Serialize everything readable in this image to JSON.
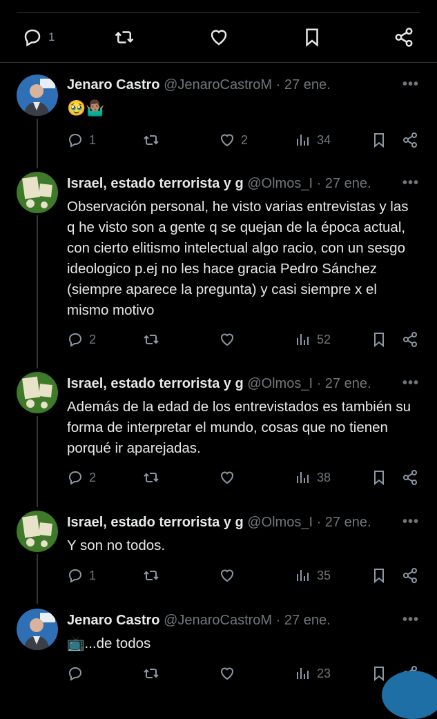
{
  "top_actions": {
    "reply_count": "1"
  },
  "tweets": [
    {
      "name": "Jenaro Castro",
      "handle": "@JenaroCastroM",
      "dot": "·",
      "date": "27 ene.",
      "more": "•••",
      "text": "🥹🤷🏽‍♂️",
      "replies": "1",
      "retweets": "",
      "likes": "2",
      "views": "34"
    },
    {
      "name": "Israel, estado terrorista y g",
      "handle": "@Olmos_I",
      "dot": "·",
      "date": "27 ene.",
      "more": "•••",
      "text": "Observación personal, he visto varias entrevistas y las q he visto son a gente q se quejan de la época actual, con cierto elitismo intelectual algo racio, con un sesgo ideologico p.ej no les hace gracia Pedro Sánchez (siempre aparece la pregunta) y casi siempre x el mismo motivo",
      "replies": "2",
      "retweets": "",
      "likes": "",
      "views": "52"
    },
    {
      "name": "Israel, estado terrorista y g",
      "handle": "@Olmos_I",
      "dot": "·",
      "date": "27 ene.",
      "more": "•••",
      "text": "Además de la edad de los entrevistados es también su forma de interpretar el mundo, cosas que no tienen porqué ir aparejadas.",
      "replies": "2",
      "retweets": "",
      "likes": "",
      "views": "38"
    },
    {
      "name": "Israel, estado terrorista y g",
      "handle": "@Olmos_I",
      "dot": "·",
      "date": "27 ene.",
      "more": "•••",
      "text": "Y son no todos.",
      "replies": "1",
      "retweets": "",
      "likes": "",
      "views": "35"
    },
    {
      "name": "Jenaro Castro",
      "handle": "@JenaroCastroM",
      "dot": "·",
      "date": "27 ene.",
      "more": "•••",
      "text": "📺...de todos",
      "replies": "",
      "retweets": "",
      "likes": "",
      "views": "23"
    }
  ]
}
